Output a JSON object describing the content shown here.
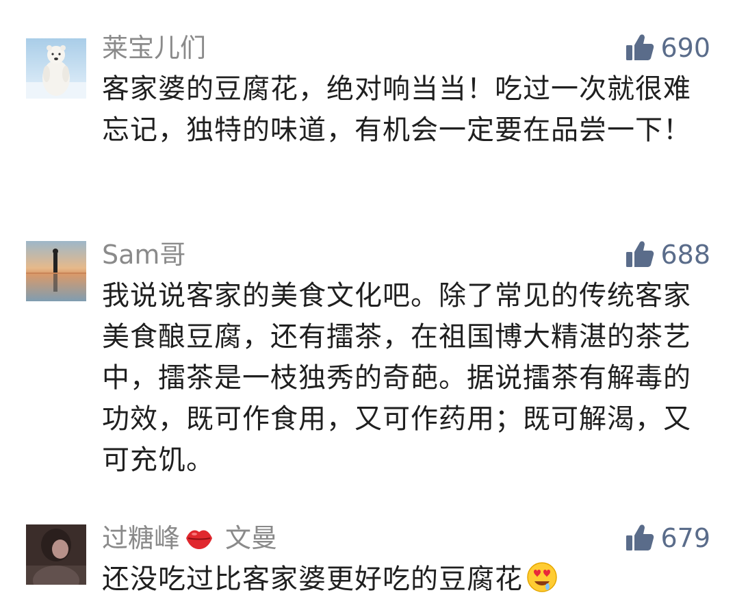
{
  "comments": [
    {
      "author": "莱宝儿们",
      "likes": "690",
      "text": "客家婆的豆腐花，绝对响当当！吃过一次就很难忘记，独特的味道，有机会一定要在品尝一下！",
      "avatar_icon": "polar-bear-avatar"
    },
    {
      "author": "Sam哥",
      "likes": "688",
      "text": "我说说客家的美食文化吧。除了常见的传统客家美食酿豆腐，还有擂茶，在祖国博大精湛的茶艺中，擂茶是一枝独秀的奇葩。据说擂茶有解毒的功效，既可作食用，又可作药用；既可解渴，又可充饥。",
      "avatar_icon": "sunset-silhouette-avatar"
    },
    {
      "author": "过糖峰",
      "author_suffix": "文曼",
      "author_emoji": "lips-emoji",
      "likes": "679",
      "text": "还没吃过比客家婆更好吃的豆腐花",
      "text_emoji": "heart-eyes-drooling-emoji",
      "avatar_icon": "photo-avatar"
    }
  ],
  "colors": {
    "author": "#8a8a8a",
    "like_icon": "#5a6c8a",
    "text": "#1f1f1f"
  }
}
